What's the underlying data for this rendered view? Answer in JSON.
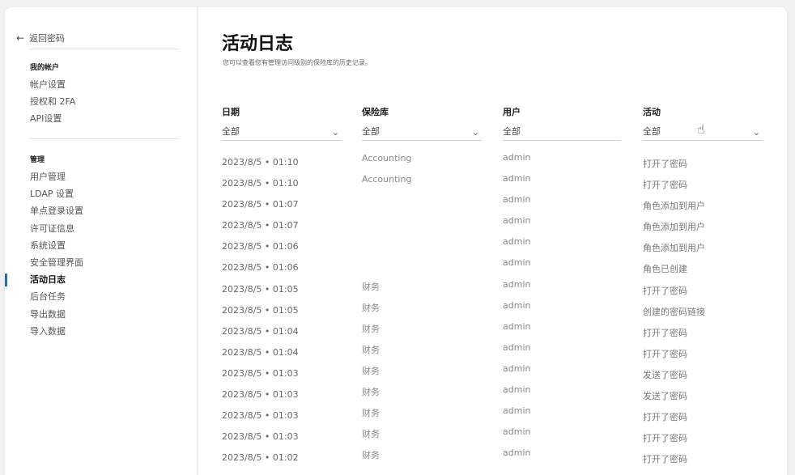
{
  "sidebar": {
    "back_label": "返回密码",
    "account_section": "我的帐户",
    "account_items": [
      "帐户设置",
      "授权和 2FA",
      "API设置"
    ],
    "admin_section": "管理",
    "admin_items": [
      "用户管理",
      "LDAP 设置",
      "单点登录设置",
      "许可证信息",
      "系统设置",
      "安全管理界面",
      "活动日志",
      "后台任务",
      "导出数据",
      "导入数据"
    ],
    "active_item": "活动日志"
  },
  "main": {
    "title": "活动日志",
    "subtitle": "您可以查看您有管理访问级别的保险库的历史记录。",
    "columns": {
      "date": "日期",
      "vault": "保险库",
      "user": "用户",
      "activity": "活动"
    },
    "filters": {
      "date": "全部",
      "vault": "全部",
      "user": "全部",
      "activity": "全部"
    }
  },
  "rows": [
    {
      "date": "2023/8/5 • 01:10",
      "vault": "Accounting",
      "user": "admin",
      "activity": "打开了密码"
    },
    {
      "date": "2023/8/5 • 01:10",
      "vault": "Accounting",
      "user": "admin",
      "activity": "打开了密码"
    },
    {
      "date": "2023/8/5 • 01:07",
      "vault": "",
      "user": "admin",
      "activity": "角色添加到用户"
    },
    {
      "date": "2023/8/5 • 01:07",
      "vault": "",
      "user": "admin",
      "activity": "角色添加到用户"
    },
    {
      "date": "2023/8/5 • 01:06",
      "vault": "",
      "user": "admin",
      "activity": "角色添加到用户"
    },
    {
      "date": "2023/8/5 • 01:06",
      "vault": "",
      "user": "admin",
      "activity": "角色已创建"
    },
    {
      "date": "2023/8/5 • 01:05",
      "vault": "财务",
      "user": "admin",
      "activity": "打开了密码"
    },
    {
      "date": "2023/8/5 • 01:05",
      "vault": "财务",
      "user": "admin",
      "activity": "创建的密码链接"
    },
    {
      "date": "2023/8/5 • 01:04",
      "vault": "财务",
      "user": "admin",
      "activity": "打开了密码"
    },
    {
      "date": "2023/8/5 • 01:04",
      "vault": "财务",
      "user": "admin",
      "activity": "打开了密码"
    },
    {
      "date": "2023/8/5 • 01:03",
      "vault": "财务",
      "user": "admin",
      "activity": "发送了密码"
    },
    {
      "date": "2023/8/5 • 01:03",
      "vault": "财务",
      "user": "admin",
      "activity": "发送了密码"
    },
    {
      "date": "2023/8/5 • 01:03",
      "vault": "财务",
      "user": "admin",
      "activity": "打开了密码"
    },
    {
      "date": "2023/8/5 • 01:03",
      "vault": "财务",
      "user": "admin",
      "activity": "打开了密码"
    },
    {
      "date": "2023/8/5 • 01:02",
      "vault": "财务",
      "user": "admin",
      "activity": "打开了密码"
    }
  ],
  "icons": {
    "back": "arrow-left-icon",
    "dropdown": "chevron-down-icon",
    "cursor": "hand-pointer-icon"
  },
  "colors": {
    "active_indicator": "#2b6cb0"
  }
}
